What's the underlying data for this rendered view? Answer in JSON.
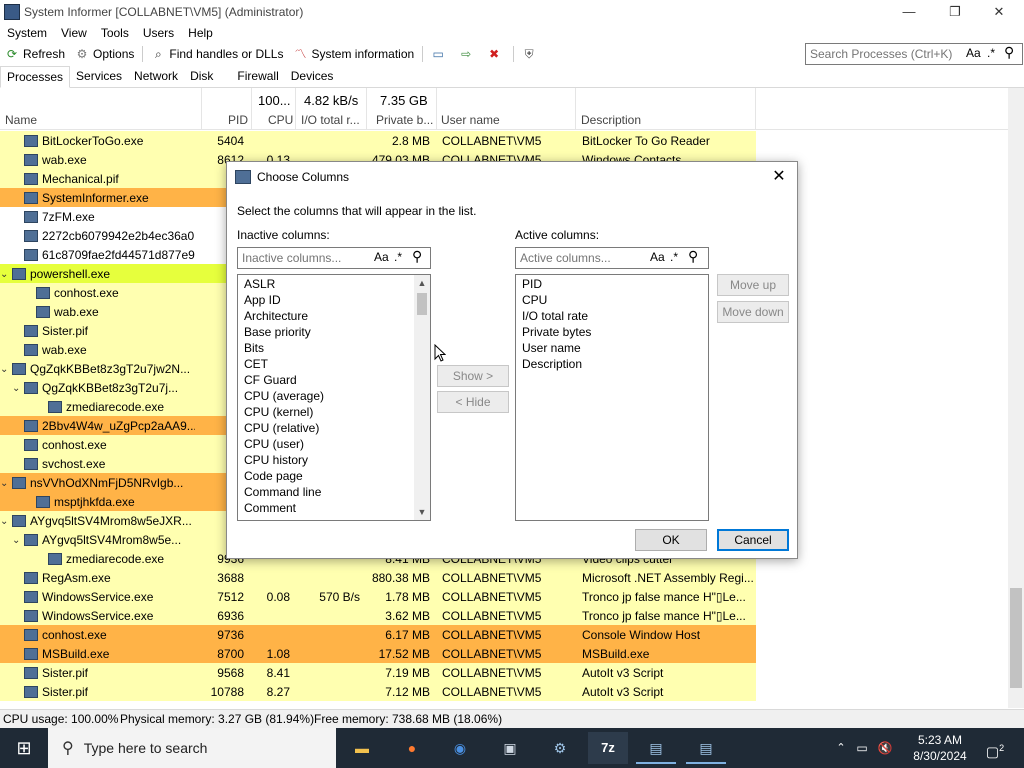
{
  "window": {
    "title": "System Informer [COLLABNET\\VM5] (Administrator)",
    "controls": [
      "—",
      "❐",
      "✕"
    ]
  },
  "menu": [
    "System",
    "View",
    "Tools",
    "Users",
    "Help"
  ],
  "toolbar": {
    "refresh": "Refresh",
    "options": "Options",
    "find": "Find handles or DLLs",
    "sysinfo": "System information"
  },
  "search": {
    "placeholder": "Search Processes (Ctrl+K)",
    "case": "Aa",
    "regex": ".*"
  },
  "tabs": [
    "Processes",
    "Services",
    "Network",
    "Disk",
    "Firewall",
    "Devices"
  ],
  "columns": {
    "name": "Name",
    "pid": "PID",
    "cpu_total": "100...",
    "cpu": "CPU",
    "io_total": "4.82 kB/s",
    "io": "I/O total r...",
    "pb_total": "7.35 GB",
    "pb": "Private b...",
    "user": "User name",
    "desc": "Description"
  },
  "processes": [
    {
      "name": "BitLockerToGo.exe",
      "pid": "5404",
      "cpu": "",
      "io": "",
      "pb": "2.8 MB",
      "user": "COLLABNET\\VM5",
      "desc": "BitLocker To Go Reader",
      "color": "#ffffb0",
      "indent": 1
    },
    {
      "name": "wab.exe",
      "pid": "8612",
      "cpu": "0.13",
      "io": "",
      "pb": "479.03 MB",
      "user": "COLLABNET\\VM5",
      "desc": "Windows Contacts",
      "color": "#ffffb0",
      "indent": 1
    },
    {
      "name": "Mechanical.pif",
      "pid": "",
      "cpu": "",
      "io": "",
      "pb": "",
      "user": "",
      "desc": "",
      "color": "#ffffb0",
      "indent": 1
    },
    {
      "name": "SystemInformer.exe",
      "pid": "7",
      "cpu": "",
      "io": "",
      "pb": "",
      "user": "",
      "desc": "",
      "color": "#ffb347",
      "indent": 1
    },
    {
      "name": "7zFM.exe",
      "pid": "10",
      "cpu": "",
      "io": "",
      "pb": "",
      "user": "",
      "desc": "",
      "color": "#ffffff",
      "indent": 1
    },
    {
      "name": "2272cb6079942e2b4ec36a0...",
      "pid": "9",
      "cpu": "",
      "io": "",
      "pb": "",
      "user": "",
      "desc": "",
      "color": "#ffffff",
      "indent": 1
    },
    {
      "name": "61c8709fae2fd44571d877e9...",
      "pid": "3",
      "cpu": "",
      "io": "",
      "pb": "",
      "user": "",
      "desc": "",
      "color": "#ffffff",
      "indent": 1
    },
    {
      "name": "powershell.exe",
      "pid": "3",
      "cpu": "",
      "io": "",
      "pb": "",
      "user": "",
      "desc": "",
      "color": "#e6ff3d",
      "indent": 0,
      "expand": "⌄"
    },
    {
      "name": "conhost.exe",
      "pid": "",
      "cpu": "",
      "io": "",
      "pb": "",
      "user": "",
      "desc": "",
      "color": "#ffffb0",
      "indent": 2
    },
    {
      "name": "wab.exe",
      "pid": "9",
      "cpu": "",
      "io": "",
      "pb": "",
      "user": "",
      "desc": "",
      "color": "#ffffb0",
      "indent": 2
    },
    {
      "name": "Sister.pif",
      "pid": "6",
      "cpu": "",
      "io": "",
      "pb": "",
      "user": "",
      "desc": "",
      "color": "#ffffb0",
      "indent": 1
    },
    {
      "name": "wab.exe",
      "pid": "11",
      "cpu": "",
      "io": "",
      "pb": "",
      "user": "",
      "desc": "",
      "color": "#ffffb0",
      "indent": 1
    },
    {
      "name": "QgZqkKBBet8z3gT2u7jw2N...",
      "pid": "3",
      "cpu": "",
      "io": "",
      "pb": "",
      "user": "",
      "desc": "",
      "color": "#ffffb0",
      "indent": 0,
      "expand": "⌄"
    },
    {
      "name": "QgZqkKBBet8z3gT2u7j...",
      "pid": "",
      "cpu": "",
      "io": "",
      "pb": "",
      "user": "",
      "desc": "",
      "color": "#ffffb0",
      "indent": 1,
      "expand": "⌄"
    },
    {
      "name": "zmediarecode.exe",
      "pid": "10",
      "cpu": "",
      "io": "",
      "pb": "",
      "user": "",
      "desc": "",
      "color": "#ffffb0",
      "indent": 3
    },
    {
      "name": "2Bbv4W4w_uZgPcp2aAA9...",
      "pid": "8",
      "cpu": "",
      "io": "",
      "pb": "",
      "user": "",
      "desc": "",
      "color": "#ffb347",
      "indent": 1
    },
    {
      "name": "conhost.exe",
      "pid": "",
      "cpu": "",
      "io": "",
      "pb": "",
      "user": "",
      "desc": "",
      "color": "#ffffb0",
      "indent": 1
    },
    {
      "name": "svchost.exe",
      "pid": "",
      "cpu": "",
      "io": "",
      "pb": "",
      "user": "",
      "desc": "",
      "color": "#ffffb0",
      "indent": 1
    },
    {
      "name": "nsVVhOdXNmFjD5NRvIgb...",
      "pid": "9",
      "cpu": "",
      "io": "",
      "pb": "",
      "user": "",
      "desc": "",
      "color": "#ffb347",
      "indent": 0,
      "expand": "⌄"
    },
    {
      "name": "msptjhkfda.exe",
      "pid": "",
      "cpu": "",
      "io": "",
      "pb": "",
      "user": "",
      "desc": "",
      "color": "#ffb347",
      "indent": 2
    },
    {
      "name": "AYgvq5ltSV4Mrom8w5eJXR...",
      "pid": "10",
      "cpu": "",
      "io": "",
      "pb": "",
      "user": "",
      "desc": "",
      "color": "#ffffb0",
      "indent": 0,
      "expand": "⌄"
    },
    {
      "name": "AYgvq5ltSV4Mrom8w5e...",
      "pid": "3",
      "cpu": "",
      "io": "",
      "pb": "",
      "user": "",
      "desc": "",
      "color": "#ffffb0",
      "indent": 1,
      "expand": "⌄"
    },
    {
      "name": "zmediarecode.exe",
      "pid": "9936",
      "cpu": "",
      "io": "",
      "pb": "8.41 MB",
      "user": "COLLABNET\\VM5",
      "desc": "Video clips cutter",
      "color": "#ffffb0",
      "indent": 3
    },
    {
      "name": "RegAsm.exe",
      "pid": "3688",
      "cpu": "",
      "io": "",
      "pb": "880.38 MB",
      "user": "COLLABNET\\VM5",
      "desc": "Microsoft .NET Assembly Regi...",
      "color": "#ffffb0",
      "indent": 1
    },
    {
      "name": "WindowsService.exe",
      "pid": "7512",
      "cpu": "0.08",
      "io": "570 B/s",
      "pb": "1.78 MB",
      "user": "COLLABNET\\VM5",
      "desc": "Tronco jp false mance  H\"▯Le...",
      "color": "#ffffb0",
      "indent": 1
    },
    {
      "name": "WindowsService.exe",
      "pid": "6936",
      "cpu": "",
      "io": "",
      "pb": "3.62 MB",
      "user": "COLLABNET\\VM5",
      "desc": "Tronco jp false mance  H\"▯Le...",
      "color": "#ffffb0",
      "indent": 1
    },
    {
      "name": "conhost.exe",
      "pid": "9736",
      "cpu": "",
      "io": "",
      "pb": "6.17 MB",
      "user": "COLLABNET\\VM5",
      "desc": "Console Window Host",
      "color": "#ffb347",
      "indent": 1
    },
    {
      "name": "MSBuild.exe",
      "pid": "8700",
      "cpu": "1.08",
      "io": "",
      "pb": "17.52 MB",
      "user": "COLLABNET\\VM5",
      "desc": "MSBuild.exe",
      "color": "#ffb347",
      "indent": 1
    },
    {
      "name": "Sister.pif",
      "pid": "9568",
      "cpu": "8.41",
      "io": "",
      "pb": "7.19 MB",
      "user": "COLLABNET\\VM5",
      "desc": "AutoIt v3 Script",
      "color": "#ffffb0",
      "indent": 1
    },
    {
      "name": "Sister.pif",
      "pid": "10788",
      "cpu": "8.27",
      "io": "",
      "pb": "7.12 MB",
      "user": "COLLABNET\\VM5",
      "desc": "AutoIt v3 Script",
      "color": "#ffffb0",
      "indent": 1
    }
  ],
  "status": {
    "cpu": "CPU usage: 100.00%",
    "phys": "Physical memory: 3.27 GB (81.94%)",
    "free": "Free memory: 738.68 MB (18.06%)"
  },
  "taskbar": {
    "search_placeholder": "Type here to search",
    "time": "5:23 AM",
    "date": "8/30/2024",
    "notif_count": "2"
  },
  "dialog": {
    "title": "Choose Columns",
    "instruction": "Select the columns that will appear in the list.",
    "inactive_label": "Inactive columns:",
    "active_label": "Active columns:",
    "inactive_placeholder": "Inactive columns...",
    "active_placeholder": "Active columns...",
    "case": "Aa",
    "regex": ".*",
    "inactive": [
      "ASLR",
      "App ID",
      "Architecture",
      "Base priority",
      "Bits",
      "CET",
      "CF Guard",
      "CPU (average)",
      "CPU (kernel)",
      "CPU (relative)",
      "CPU (user)",
      "CPU history",
      "Code page",
      "Command line",
      "Comment"
    ],
    "active": [
      "PID",
      "CPU",
      "I/O total rate",
      "Private bytes",
      "User name",
      "Description"
    ],
    "show": "Show >",
    "hide": "< Hide",
    "move_up": "Move up",
    "move_down": "Move down",
    "ok": "OK",
    "cancel": "Cancel"
  }
}
